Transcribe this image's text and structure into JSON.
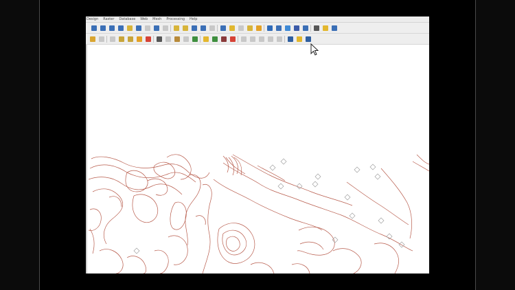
{
  "menubar": {
    "items": [
      "Design",
      "Raster",
      "Database",
      "Web",
      "Mesh",
      "Processing",
      "Help"
    ]
  },
  "toolbar_row1": {
    "tools": [
      {
        "icon": "pan-icon",
        "color": "#3b6fb6"
      },
      {
        "icon": "zoom-in-icon",
        "color": "#3b6fb6"
      },
      {
        "icon": "zoom-out-icon",
        "color": "#3b6fb6"
      },
      {
        "icon": "zoom-full-icon",
        "color": "#3b6fb6"
      },
      {
        "icon": "zoom-selection-icon",
        "color": "#d7b43a"
      },
      {
        "icon": "zoom-layer-icon",
        "color": "#3b6fb6"
      },
      {
        "icon": "zoom-native-icon",
        "color": "#9a9a9a"
      },
      {
        "icon": "zoom-last-icon",
        "color": "#3b6fb6"
      },
      {
        "icon": "zoom-next-icon",
        "color": "#9a9a9a"
      },
      {
        "icon": "new-map-view-icon",
        "color": "#d7b43a"
      },
      {
        "icon": "new-3d-view-icon",
        "color": "#d7b43a"
      },
      {
        "icon": "temporal-icon",
        "color": "#3b6fb6"
      },
      {
        "icon": "bookmark-icon",
        "color": "#3b6fb6"
      },
      {
        "icon": "show-bookmarks-icon",
        "color": "#9a9a9a"
      },
      {
        "icon": "refresh-icon",
        "color": "#3b6fb6"
      },
      {
        "icon": "select-features-icon",
        "color": "#e0b72f"
      },
      {
        "icon": "select-by-value-icon",
        "color": "#9a9a9a"
      },
      {
        "icon": "deselect-icon",
        "color": "#d7b43a"
      },
      {
        "icon": "select-all-icon",
        "color": "#e3a126"
      },
      {
        "icon": "identify-icon",
        "color": "#2f6ab8"
      },
      {
        "icon": "attribute-table-icon",
        "color": "#3b6fb6"
      },
      {
        "icon": "settings-gear-icon",
        "color": "#3f8ad6"
      },
      {
        "icon": "sum-icon",
        "color": "#3b5aa8"
      },
      {
        "icon": "field-calculator-icon",
        "color": "#3b6fb6"
      },
      {
        "icon": "measure-icon",
        "color": "#555555"
      },
      {
        "icon": "map-tips-icon",
        "color": "#e3b72e"
      },
      {
        "icon": "annotation-icon",
        "color": "#3b6fb6"
      }
    ]
  },
  "toolbar_row2": {
    "tools": [
      {
        "icon": "pencil-edit-icon",
        "color": "#d9a531"
      },
      {
        "icon": "save-edits-icon",
        "color": "#9a9a9a"
      },
      {
        "icon": "digitize-icon",
        "color": "#9a9a9a"
      },
      {
        "icon": "vertex-tool-icon",
        "color": "#c8a53a"
      },
      {
        "icon": "add-feature-icon",
        "color": "#c8a53a"
      },
      {
        "icon": "edit-attributes-icon",
        "color": "#e3a126"
      },
      {
        "icon": "delete-icon",
        "color": "#d64236"
      },
      {
        "icon": "cut-icon",
        "color": "#555555"
      },
      {
        "icon": "copy-icon",
        "color": "#9a9a9a"
      },
      {
        "icon": "paste-icon",
        "color": "#b88a3a"
      },
      {
        "icon": "undo-icon",
        "color": "#9a9a9a"
      },
      {
        "icon": "redo-icon",
        "color": "#3f8f3f"
      },
      {
        "icon": "label-icon",
        "color": "#e3b72e"
      },
      {
        "icon": "label-style-icon",
        "color": "#3f8f3f"
      },
      {
        "icon": "pin-label-icon",
        "color": "#8a3a3a"
      },
      {
        "icon": "rotate-label-icon",
        "color": "#d64236"
      },
      {
        "icon": "label-tool-icon",
        "color": "#9a9a9a"
      },
      {
        "icon": "label-tool-2-icon",
        "color": "#9a9a9a"
      },
      {
        "icon": "label-tool-3-icon",
        "color": "#9a9a9a"
      },
      {
        "icon": "label-tool-4-icon",
        "color": "#9a9a9a"
      },
      {
        "icon": "label-tool-5-icon",
        "color": "#9a9a9a"
      },
      {
        "icon": "python-console-icon",
        "color": "#2f5fa0"
      },
      {
        "icon": "plugin-icon",
        "color": "#e3b72e"
      },
      {
        "icon": "help-icon",
        "color": "#2f5fa0"
      }
    ]
  },
  "map": {
    "contour_color": "#b75a4a",
    "background": "#ffffff"
  }
}
